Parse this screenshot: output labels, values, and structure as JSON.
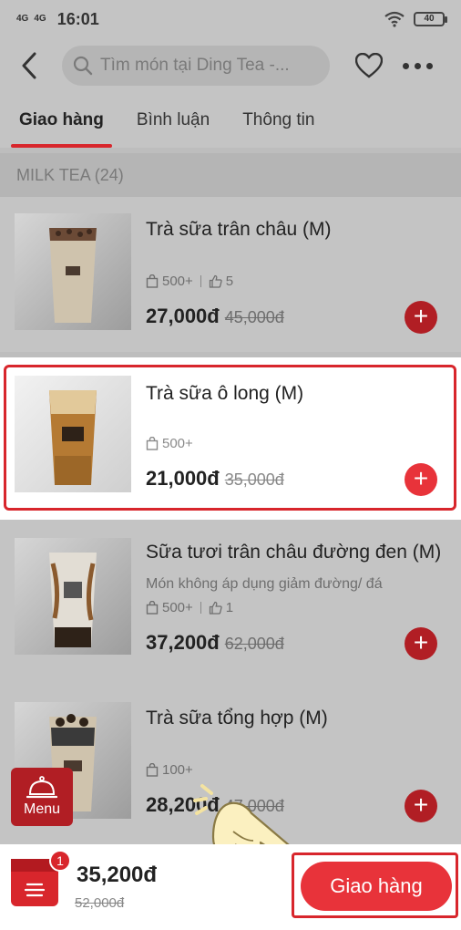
{
  "status_bar": {
    "signal1": "4G",
    "signal2": "4G",
    "time": "16:01",
    "battery": "40"
  },
  "header": {
    "search_placeholder": "Tìm món tại Ding Tea -..."
  },
  "tabs": [
    {
      "label": "Giao hàng",
      "active": true
    },
    {
      "label": "Bình luận",
      "active": false
    },
    {
      "label": "Thông tin",
      "active": false
    }
  ],
  "section": {
    "title": "MILK TEA (24)"
  },
  "products": [
    {
      "name": "Trà sữa trân châu (M)",
      "note": "",
      "sold": "500+",
      "likes": "5",
      "price": "27,000đ",
      "old_price": "45,000đ",
      "add": "+"
    },
    {
      "name": "Trà sữa ô long (M)",
      "note": "",
      "sold": "500+",
      "likes": "",
      "price": "21,000đ",
      "old_price": "35,000đ",
      "add": "+"
    },
    {
      "name": "Sữa tươi trân châu đường đen (M)",
      "note": "Món không áp dụng giảm đường/ đá",
      "sold": "500+",
      "likes": "1",
      "price": "37,200đ",
      "old_price": "62,000đ",
      "add": "+"
    },
    {
      "name": "Trà sữa tổng hợp (M)",
      "note": "",
      "sold": "100+",
      "likes": "",
      "price": "28,200đ",
      "old_price": "47,000đ",
      "add": "+"
    }
  ],
  "menu_fab": {
    "label": "Menu"
  },
  "cart": {
    "badge": "1",
    "total": "35,200đ",
    "old_total": "52,000đ",
    "order_button": "Giao hàng"
  },
  "colors": {
    "accent": "#d8262c",
    "dim_overlay": "#c4c4c4"
  }
}
